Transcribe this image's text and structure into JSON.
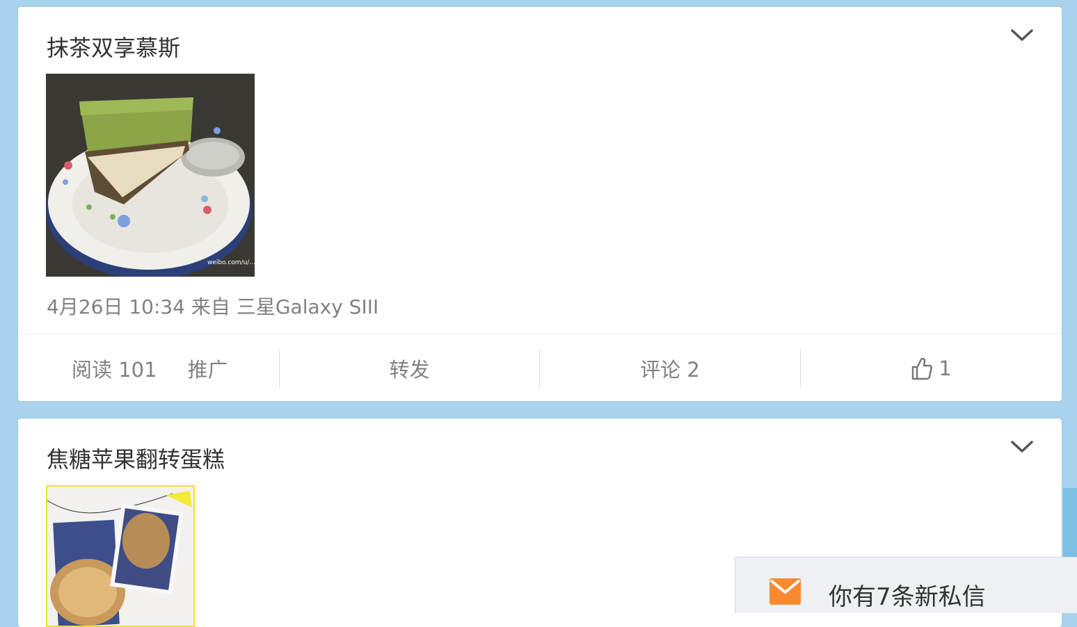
{
  "posts": [
    {
      "title": "抹茶双享慕斯",
      "meta": "4月26日 10:34 来自 三星Galaxy SIII",
      "image_watermark": "weibo.com/u/...",
      "actions": {
        "read": "阅读 101",
        "promote": "推广",
        "forward": "转发",
        "comment": "评论 2",
        "likes": "1"
      }
    },
    {
      "title": "焦糖苹果翻转蛋糕"
    }
  ],
  "notification": {
    "message": "你有7条新私信",
    "icon": "mail-icon"
  },
  "colors": {
    "background": "#a9d3ec",
    "card": "#ffffff",
    "muted_text": "#808080",
    "mail_orange": "#f98a32"
  }
}
